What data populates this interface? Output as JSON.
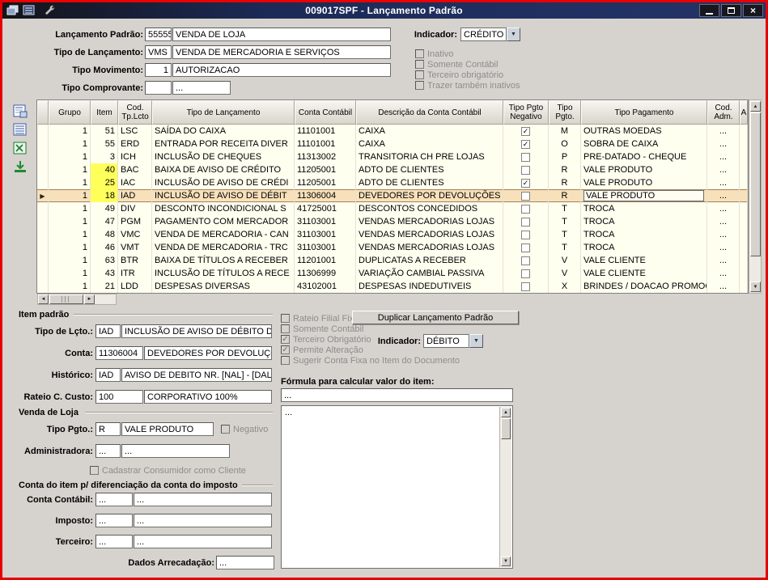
{
  "window": {
    "title": "009017SPF - Lançamento Padrão"
  },
  "form": {
    "lancamento": {
      "label": "Lançamento Padrão:",
      "code": "55555",
      "desc": "VENDA DE LOJA"
    },
    "tipo_lancamento": {
      "label": "Tipo de Lançamento:",
      "code": "VMS",
      "desc": "VENDA DE MERCADORIA E SERVIÇOS"
    },
    "tipo_movimento": {
      "label": "Tipo Movimento:",
      "code": "1",
      "desc": "AUTORIZACAO"
    },
    "tipo_comprovante": {
      "label": "Tipo Comprovante:",
      "code": "",
      "desc": "..."
    },
    "indicador": {
      "label": "Indicador:",
      "value": "CRÉDITO"
    },
    "checkboxes": [
      {
        "label": "Inativo",
        "checked": false,
        "disabled": true
      },
      {
        "label": "Somente Contábil",
        "checked": false,
        "disabled": true
      },
      {
        "label": "Terceiro obrigatório",
        "checked": false,
        "disabled": true
      },
      {
        "label": "Trazer também inativos",
        "checked": false,
        "disabled": true
      }
    ]
  },
  "grid": {
    "columns": [
      {
        "key": "grupo",
        "label": "Grupo"
      },
      {
        "key": "item",
        "label": "Item"
      },
      {
        "key": "cod",
        "label": "Cod. Tp.Lcto"
      },
      {
        "key": "tipo",
        "label": "Tipo de Lançamento"
      },
      {
        "key": "conta",
        "label": "Conta Contábil"
      },
      {
        "key": "descricao",
        "label": "Descrição da Conta Contábil"
      },
      {
        "key": "negativo",
        "label": "Tipo Pgto Negativo"
      },
      {
        "key": "tipo_pgto",
        "label": "Tipo Pgto."
      },
      {
        "key": "pagamento",
        "label": "Tipo Pagamento"
      },
      {
        "key": "cod_adm",
        "label": "Cod. Adm."
      },
      {
        "key": "a",
        "label": "A"
      }
    ],
    "rows": [
      {
        "grupo": "1",
        "item": "51",
        "cod": "LSC",
        "tipo": "SAÍDA DO CAIXA",
        "conta": "11101001",
        "descricao": "CAIXA",
        "negativo": true,
        "tipo_pgto": "M",
        "pagamento": "OUTRAS MOEDAS",
        "cod_adm": "...",
        "a": "",
        "item_hl": false,
        "selected": false
      },
      {
        "grupo": "1",
        "item": "55",
        "cod": "ERD",
        "tipo": "ENTRADA POR RECEITA DIVER",
        "conta": "11101001",
        "descricao": "CAIXA",
        "negativo": true,
        "tipo_pgto": "O",
        "pagamento": "SOBRA DE CAIXA",
        "cod_adm": "...",
        "a": "",
        "item_hl": false,
        "selected": false
      },
      {
        "grupo": "1",
        "item": "3",
        "cod": "ICH",
        "tipo": "INCLUSÃO DE CHEQUES",
        "conta": "11313002",
        "descricao": "TRANSITORIA CH PRE LOJAS",
        "negativo": false,
        "tipo_pgto": "P",
        "pagamento": "PRE-DATADO - CHEQUE",
        "cod_adm": "...",
        "a": "",
        "item_hl": false,
        "selected": false
      },
      {
        "grupo": "1",
        "item": "40",
        "cod": "BAC",
        "tipo": "BAIXA DE AVISO DE CRÉDITO",
        "conta": "11205001",
        "descricao": "ADTO DE CLIENTES",
        "negativo": false,
        "tipo_pgto": "R",
        "pagamento": "VALE PRODUTO",
        "cod_adm": "...",
        "a": "",
        "item_hl": true,
        "selected": false
      },
      {
        "grupo": "1",
        "item": "25",
        "cod": "IAC",
        "tipo": "INCLUSÃO DE AVISO DE CRÉDI",
        "conta": "11205001",
        "descricao": "ADTO DE CLIENTES",
        "negativo": true,
        "tipo_pgto": "R",
        "pagamento": "VALE PRODUTO",
        "cod_adm": "...",
        "a": "",
        "item_hl": true,
        "selected": false
      },
      {
        "grupo": "1",
        "item": "18",
        "cod": "IAD",
        "tipo": "INCLUSÃO DE AVISO DE DÉBIT",
        "conta": "11306004",
        "descricao": "DEVEDORES POR DEVOLUÇÕES",
        "negativo": false,
        "tipo_pgto": "R",
        "pagamento": "VALE PRODUTO",
        "cod_adm": "...",
        "a": "",
        "item_hl": true,
        "selected": true
      },
      {
        "grupo": "1",
        "item": "49",
        "cod": "DIV",
        "tipo": "DESCONTO INCONDICIONAL S",
        "conta": "41725001",
        "descricao": "DESCONTOS CONCEDIDOS",
        "negativo": false,
        "tipo_pgto": "T",
        "pagamento": "TROCA",
        "cod_adm": "...",
        "a": "",
        "item_hl": false,
        "selected": false
      },
      {
        "grupo": "1",
        "item": "47",
        "cod": "PGM",
        "tipo": "PAGAMENTO COM MERCADOR",
        "conta": "31103001",
        "descricao": "VENDAS MERCADORIAS LOJAS",
        "negativo": false,
        "tipo_pgto": "T",
        "pagamento": "TROCA",
        "cod_adm": "...",
        "a": "",
        "item_hl": false,
        "selected": false
      },
      {
        "grupo": "1",
        "item": "48",
        "cod": "VMC",
        "tipo": "VENDA DE MERCADORIA - CAN",
        "conta": "31103001",
        "descricao": "VENDAS MERCADORIAS LOJAS",
        "negativo": false,
        "tipo_pgto": "T",
        "pagamento": "TROCA",
        "cod_adm": "...",
        "a": "",
        "item_hl": false,
        "selected": false
      },
      {
        "grupo": "1",
        "item": "46",
        "cod": "VMT",
        "tipo": "VENDA DE MERCADORIA - TRC",
        "conta": "31103001",
        "descricao": "VENDAS MERCADORIAS LOJAS",
        "negativo": false,
        "tipo_pgto": "T",
        "pagamento": "TROCA",
        "cod_adm": "...",
        "a": "",
        "item_hl": false,
        "selected": false
      },
      {
        "grupo": "1",
        "item": "63",
        "cod": "BTR",
        "tipo": "BAIXA DE TÍTULOS A RECEBER",
        "conta": "11201001",
        "descricao": "DUPLICATAS A RECEBER",
        "negativo": false,
        "tipo_pgto": "V",
        "pagamento": "VALE CLIENTE",
        "cod_adm": "...",
        "a": "",
        "item_hl": false,
        "selected": false
      },
      {
        "grupo": "1",
        "item": "43",
        "cod": "ITR",
        "tipo": "INCLUSÃO DE TÍTULOS A RECE",
        "conta": "11306999",
        "descricao": "VARIAÇÃO CAMBIAL PASSIVA",
        "negativo": false,
        "tipo_pgto": "V",
        "pagamento": "VALE CLIENTE",
        "cod_adm": "...",
        "a": "",
        "item_hl": false,
        "selected": false
      },
      {
        "grupo": "1",
        "item": "21",
        "cod": "LDD",
        "tipo": "DESPESAS DIVERSAS",
        "conta": "43102001",
        "descricao": "DESPESAS INDEDUTIVEIS",
        "negativo": false,
        "tipo_pgto": "X",
        "pagamento": "BRINDES / DOACAO PROMOCI...",
        "cod_adm": "...",
        "a": "",
        "item_hl": false,
        "selected": false
      }
    ]
  },
  "item_padrao": {
    "title": "Item padrão",
    "tipo_lcto": {
      "label": "Tipo de Lçto.:",
      "code": "IAD",
      "desc": "INCLUSÃO DE AVISO DE DÉBITO DO TE"
    },
    "conta": {
      "label": "Conta:",
      "code": "11306004",
      "desc": "DEVEDORES POR DEVOLUÇÕES"
    },
    "historico": {
      "label": "Histórico:",
      "code": "IAD",
      "desc": "AVISO DE DEBITO NR. [NAL] - [DAL]"
    },
    "rateio": {
      "label": "Rateio C. Custo:",
      "code": "100",
      "desc": "CORPORATIVO 100%"
    },
    "checkboxes": [
      {
        "label": "Rateio Filial Fixo",
        "checked": false,
        "disabled": true
      },
      {
        "label": "Somente Contábil",
        "checked": false,
        "disabled": true
      },
      {
        "label": "Terceiro Obrigatório",
        "checked": true,
        "disabled": true
      },
      {
        "label": "Permite Alteração",
        "checked": true,
        "disabled": true
      },
      {
        "label": "Sugerir Conta Fixa no Item do Documento",
        "checked": false,
        "disabled": true
      }
    ],
    "duplicar_button": "Duplicar Lançamento Padrão",
    "indicador": {
      "label": "Indicador:",
      "value": "DÉBITO"
    },
    "formula": {
      "label": "Fórmula para calcular valor do item:",
      "field": "...",
      "area": "..."
    }
  },
  "venda_loja": {
    "title": "Venda de Loja",
    "tipo_pgto": {
      "label": "Tipo Pgto.:",
      "code": "R",
      "desc": "VALE PRODUTO"
    },
    "negativo_checkbox": {
      "label": "Negativo",
      "checked": false,
      "disabled": true
    },
    "administradora": {
      "label": "Administradora:",
      "code": "...",
      "desc": "..."
    },
    "cadastrar_checkbox": {
      "label": "Cadastrar Consumidor como Cliente",
      "checked": false,
      "disabled": true
    }
  },
  "conta_imposto": {
    "title": "Conta do item p/ diferenciação da conta do imposto",
    "conta_contabil": {
      "label": "Conta Contábil:",
      "code": "...",
      "desc": "..."
    },
    "imposto": {
      "label": "Imposto:",
      "code": "...",
      "desc": "..."
    },
    "terceiro": {
      "label": "Terceiro:",
      "code": "...",
      "desc": "..."
    },
    "dados_arrecadacao": {
      "label": "Dados Arrecadação:",
      "value": "..."
    }
  },
  "colors": {
    "titlebar": "#1b2a57",
    "selected_row": "#f8e1ba",
    "item_highlight": "#ffff5c",
    "grid_background": "#fffff0",
    "window_border": "#e80000"
  }
}
